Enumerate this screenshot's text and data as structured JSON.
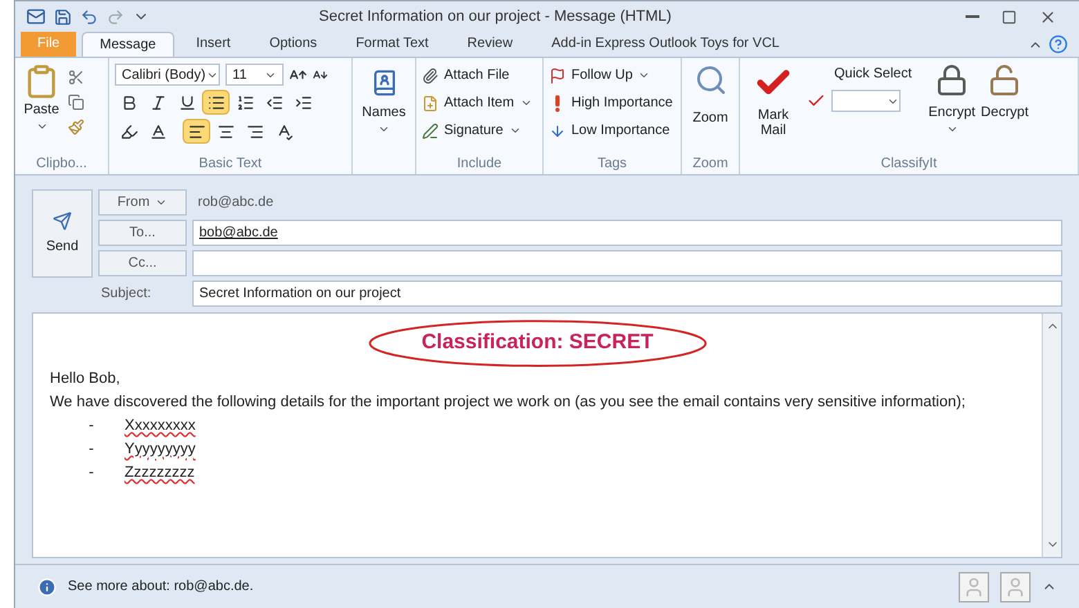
{
  "window": {
    "title": "Secret Information on our project - Message (HTML)"
  },
  "tabs": [
    {
      "label": "File",
      "kind": "file",
      "selected": false
    },
    {
      "label": "Message",
      "kind": "tab",
      "selected": true
    },
    {
      "label": "Insert",
      "kind": "tab",
      "selected": false
    },
    {
      "label": "Options",
      "kind": "tab",
      "selected": false
    },
    {
      "label": "Format Text",
      "kind": "tab",
      "selected": false
    },
    {
      "label": "Review",
      "kind": "tab",
      "selected": false
    },
    {
      "label": "Add-in Express Outlook Toys for VCL",
      "kind": "tab",
      "selected": false
    }
  ],
  "ribbon": {
    "clipboard": {
      "paste": "Paste",
      "label": "Clipbo..."
    },
    "basic_text": {
      "font": "Calibri (Body)",
      "size": "11",
      "label": "Basic Text",
      "bullets_selected": true,
      "numbering_selected": false,
      "align_left_selected": true,
      "align_center_selected": false,
      "align_right_selected": false
    },
    "names": {
      "label": "Names"
    },
    "include": {
      "items": [
        "Attach File",
        "Attach Item",
        "Signature"
      ],
      "label": "Include"
    },
    "tags": {
      "items": [
        "Follow Up",
        "High Importance",
        "Low Importance"
      ],
      "label": "Tags"
    },
    "zoom": {
      "button": "Zoom",
      "label": "Zoom"
    },
    "classifyit": {
      "mark_mail": "Mark Mail",
      "quick_select": "Quick Select",
      "encrypt": "Encrypt",
      "decrypt": "Decrypt",
      "label": "ClassifyIt"
    }
  },
  "compose": {
    "send": "Send",
    "from_button": "From",
    "from_value": "rob@abc.de",
    "to_button": "To...",
    "to_value": "bob@abc.de",
    "cc_button": "Cc...",
    "subject_label": "Subject:",
    "subject_value": "Secret Information on our project"
  },
  "body": {
    "classification": "Classification: SECRET",
    "greeting": "Hello Bob,",
    "paragraph": "We have discovered the following details for the important project we work on (as you see the email contains very sensitive information);",
    "list": [
      {
        "marker": "-",
        "text": "Xxxxxxxxx"
      },
      {
        "marker": "-",
        "text": "Yyyyyyyyy"
      },
      {
        "marker": "-",
        "text": "Zzzzzzzzz"
      }
    ]
  },
  "people_pane": {
    "text": "See more about: rob@abc.de."
  }
}
